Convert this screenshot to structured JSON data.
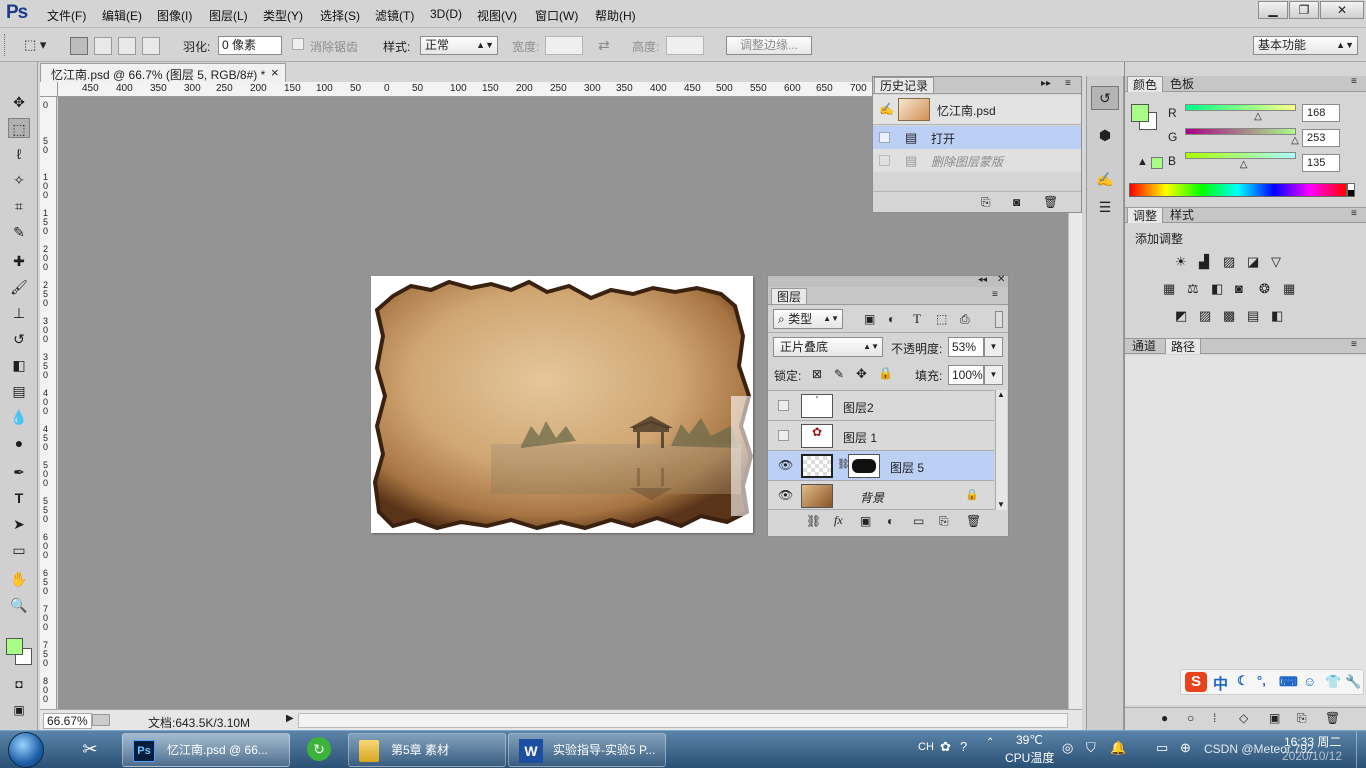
{
  "app": {
    "logo": "Ps"
  },
  "menu": [
    "文件(F)",
    "编辑(E)",
    "图像(I)",
    "图层(L)",
    "类型(Y)",
    "选择(S)",
    "滤镜(T)",
    "3D(D)",
    "视图(V)",
    "窗口(W)",
    "帮助(H)"
  ],
  "window_controls": {
    "minimize": "▁",
    "restore": "❐",
    "close": "✕"
  },
  "options_bar": {
    "feather_label": "羽化:",
    "feather_value": "0 像素",
    "antialias_label": "消除锯齿",
    "style_label": "样式:",
    "style_value": "正常",
    "width_label": "宽度:",
    "height_label": "高度:",
    "refine_edge": "调整边缘...",
    "workspace": "基本功能"
  },
  "document": {
    "tab_title": "忆江南.psd @ 66.7% (图层 5, RGB/8#) *",
    "tab_close": "×",
    "zoom": "66.67%",
    "doc_info": "文档:643.5K/3.10M",
    "ruler_h": [
      "450",
      "400",
      "350",
      "300",
      "250",
      "200",
      "150",
      "100",
      "50",
      "0",
      "50",
      "100",
      "150",
      "200",
      "250",
      "300",
      "350",
      "400",
      "450",
      "500",
      "550",
      "600",
      "650",
      "700"
    ],
    "ruler_v": [
      "0",
      "5 0",
      "1 0 0",
      "1 5 0",
      "2 0 0",
      "2 5 0",
      "3 0 0",
      "3 5 0",
      "4 0 0",
      "4 5 0",
      "5 0 0",
      "5 5 0",
      "6 0 0",
      "6 5 0",
      "7 0 0",
      "7 5 0",
      "8 0 0"
    ]
  },
  "history_panel": {
    "title": "历史记录",
    "snapshot": "忆江南.psd",
    "items": [
      {
        "label": "打开",
        "selected": true
      },
      {
        "label": "删除图层蒙版",
        "selected": false
      }
    ]
  },
  "layers_panel": {
    "title": "图层",
    "filter": "类型",
    "blend_mode": "正片叠底",
    "opacity_label": "不透明度:",
    "opacity": "53%",
    "lock_label": "锁定:",
    "fill_label": "填充:",
    "fill": "100%",
    "layers": [
      {
        "name": "图层2",
        "visible": false,
        "selected": false
      },
      {
        "name": "图层 1",
        "visible": false,
        "selected": false
      },
      {
        "name": "图层 5",
        "visible": true,
        "selected": true
      },
      {
        "name": "背景",
        "visible": true,
        "selected": false
      }
    ],
    "bottom_icons": [
      "link-icon",
      "fx-icon",
      "mask-icon",
      "adjustment-icon",
      "group-icon",
      "new-layer-icon",
      "trash-icon"
    ]
  },
  "color_panel": {
    "tabs": [
      "颜色",
      "色板"
    ],
    "r_label": "R",
    "g_label": "G",
    "b_label": "B",
    "r": "168",
    "g": "253",
    "b": "135",
    "r_level": 0.659,
    "g_level": 0.992,
    "b_level": 0.529,
    "foreground": "#a8fd87"
  },
  "adjust_panel": {
    "tabs": [
      "调整",
      "样式"
    ],
    "heading": "添加调整"
  },
  "paths_panel": {
    "tabs": [
      "通道",
      "路径"
    ]
  },
  "taskbar": {
    "buttons": [
      "忆江南.psd @ 66...",
      "第5章 素材",
      "实验指导-实验5 P..."
    ],
    "temperature": "39℃",
    "cpu_label": "CPU温度",
    "lang": "CH",
    "time": "16:33 周二",
    "date": "2020/10/12",
    "watermark": "CSDN @Meteor.792"
  },
  "ime": {
    "label": "中"
  },
  "colors": {
    "accent": "#1b3d8a",
    "selected_row": "#bcd0f5",
    "canvas": "#949494"
  }
}
